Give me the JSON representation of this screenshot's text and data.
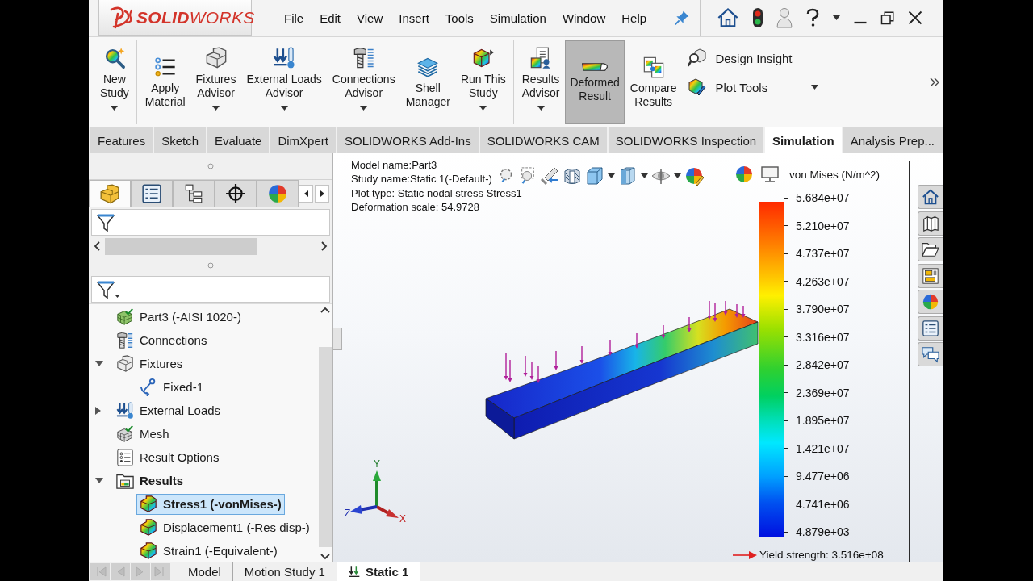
{
  "logo": {
    "wordmark": "**SOLID**WORKS"
  },
  "menu": [
    "File",
    "Edit",
    "View",
    "Insert",
    "Tools",
    "Simulation",
    "Window",
    "Help"
  ],
  "ribbon": {
    "groups": [
      {
        "buttons": [
          {
            "label": "New\nStudy",
            "dropdown": true,
            "selected": false
          }
        ]
      },
      {
        "buttons": [
          {
            "label": "Apply\nMaterial",
            "dropdown": false,
            "selected": false
          },
          {
            "label": "Fixtures\nAdvisor",
            "dropdown": true,
            "selected": false
          },
          {
            "label": "External Loads\nAdvisor",
            "dropdown": true,
            "selected": false
          },
          {
            "label": "Connections\nAdvisor",
            "dropdown": true,
            "selected": false
          },
          {
            "label": "Shell\nManager",
            "dropdown": false,
            "selected": false
          },
          {
            "label": "Run This\nStudy",
            "dropdown": true,
            "selected": false
          }
        ]
      },
      {
        "buttons": [
          {
            "label": "Results\nAdvisor",
            "dropdown": true,
            "selected": false
          },
          {
            "label": "Deformed\nResult",
            "dropdown": false,
            "selected": true
          },
          {
            "label": "Compare\nResults",
            "dropdown": false,
            "selected": false
          }
        ]
      }
    ],
    "tools": [
      {
        "label": "Design Insight",
        "dropdown": false
      },
      {
        "label": "Plot Tools",
        "dropdown": true
      }
    ]
  },
  "command_tabs": [
    {
      "label": "Features",
      "selected": false
    },
    {
      "label": "Sketch",
      "selected": false
    },
    {
      "label": "Evaluate",
      "selected": false
    },
    {
      "label": "DimXpert",
      "selected": false
    },
    {
      "label": "SOLIDWORKS Add-Ins",
      "selected": false
    },
    {
      "label": "SOLIDWORKS CAM",
      "selected": false
    },
    {
      "label": "SOLIDWORKS Inspection",
      "selected": false
    },
    {
      "label": "Simulation",
      "selected": true
    },
    {
      "label": "Analysis Prep...",
      "selected": false
    }
  ],
  "feature_manager": {
    "panel_tabs": [
      {
        "selected": true
      },
      {
        "selected": false
      },
      {
        "selected": false
      },
      {
        "selected": false
      },
      {
        "selected": false
      }
    ],
    "tree": [
      {
        "label": "Part3 (-AISI 1020-)",
        "selected": false,
        "active": false
      },
      {
        "label": "Connections",
        "selected": false,
        "active": false
      },
      {
        "label": "Fixtures",
        "selected": false,
        "active": false,
        "expanded": true,
        "children": [
          {
            "label": "Fixed-1",
            "selected": false,
            "active": false
          }
        ]
      },
      {
        "label": "External Loads",
        "selected": false,
        "active": false,
        "expanded": false
      },
      {
        "label": "Mesh",
        "selected": false,
        "active": false
      },
      {
        "label": "Result Options",
        "selected": false,
        "active": false
      },
      {
        "label": "Results",
        "selected": false,
        "active": true,
        "expanded": true,
        "children": [
          {
            "label": "Stress1 (-vonMises-)",
            "selected": true,
            "active": true
          },
          {
            "label": "Displacement1 (-Res disp-)",
            "selected": false,
            "active": false
          },
          {
            "label": "Strain1 (-Equivalent-)",
            "selected": false,
            "active": false
          }
        ]
      }
    ]
  },
  "viewport": {
    "info": [
      "Model name:Part3",
      "Study name:Static 1(-Default-)",
      "Plot type: Static nodal stress Stress1",
      "Deformation scale: 54.9728"
    ],
    "triad": {
      "x": "X",
      "y": "Y",
      "z": "Z"
    },
    "legend": {
      "title": "von Mises (N/m^2)",
      "labels": [
        "5.684e+07",
        "5.210e+07",
        "4.737e+07",
        "4.263e+07",
        "3.790e+07",
        "3.316e+07",
        "2.842e+07",
        "2.369e+07",
        "1.895e+07",
        "1.421e+07",
        "9.477e+06",
        "4.741e+06",
        "4.879e+03"
      ],
      "yield_strength": "Yield strength: 3.516e+08"
    }
  },
  "bottom_tabs": [
    {
      "label": "Model",
      "kind": "model",
      "selected": false
    },
    {
      "label": "Motion Study 1",
      "kind": "motion",
      "selected": false
    },
    {
      "label": "Static 1",
      "kind": "static",
      "selected": true
    }
  ]
}
